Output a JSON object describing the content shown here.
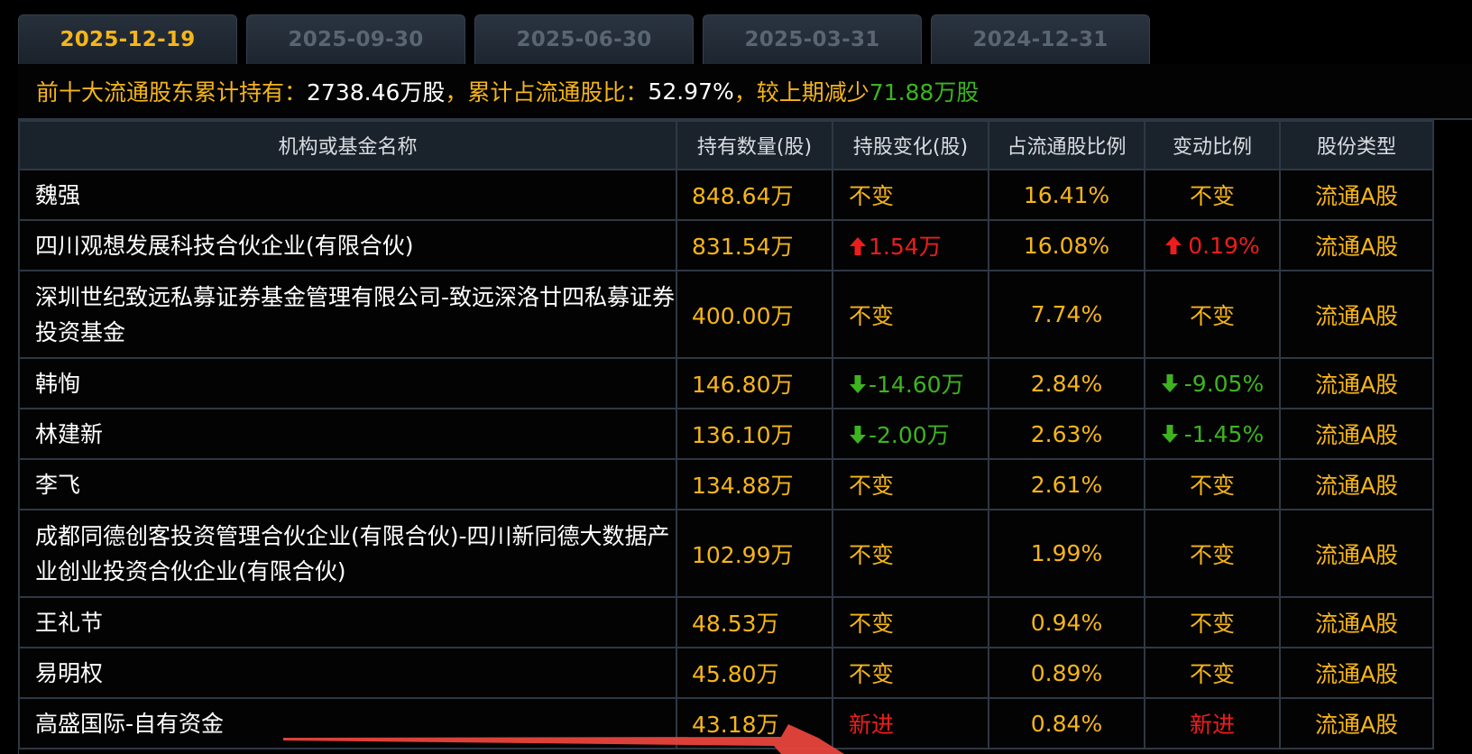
{
  "tabs": [
    {
      "label": "2025-12-19",
      "active": true
    },
    {
      "label": "2025-09-30",
      "active": false
    },
    {
      "label": "2025-06-30",
      "active": false
    },
    {
      "label": "2025-03-31",
      "active": false
    },
    {
      "label": "2024-12-31",
      "active": false
    }
  ],
  "summary": {
    "label1": "前十大流通股东累计持有：",
    "value1": "2738.46万股",
    "label2": "，累计占流通股比：",
    "value2": "52.97%",
    "label3": "，较上期减少",
    "value3": "71.88万股"
  },
  "table": {
    "headers": [
      "机构或基金名称",
      "持有数量(股)",
      "持股变化(股)",
      "占流通股比例",
      "变动比例",
      "股份类型"
    ],
    "rows": [
      {
        "name": "魏强",
        "qty": "848.64万",
        "change": "不变",
        "change_dir": "none",
        "change_color": "yellow",
        "pct": "16.41%",
        "ratio": "不变",
        "ratio_dir": "none",
        "ratio_color": "yellow",
        "type": "流通A股"
      },
      {
        "name": "四川观想发展科技合伙企业(有限合伙)",
        "qty": "831.54万",
        "change": "1.54万",
        "change_dir": "up",
        "change_color": "red",
        "pct": "16.08%",
        "ratio": "0.19%",
        "ratio_dir": "up",
        "ratio_color": "red",
        "type": "流通A股"
      },
      {
        "name": "深圳世纪致远私募证券基金管理有限公司-致远深洛廿四私募证券投资基金",
        "qty": "400.00万",
        "change": "不变",
        "change_dir": "none",
        "change_color": "yellow",
        "pct": "7.74%",
        "ratio": "不变",
        "ratio_dir": "none",
        "ratio_color": "yellow",
        "type": "流通A股",
        "tall": true
      },
      {
        "name": "韩恂",
        "qty": "146.80万",
        "change": "-14.60万",
        "change_dir": "down",
        "change_color": "green",
        "pct": "2.84%",
        "ratio": "-9.05%",
        "ratio_dir": "down",
        "ratio_color": "green",
        "type": "流通A股"
      },
      {
        "name": "林建新",
        "qty": "136.10万",
        "change": "-2.00万",
        "change_dir": "down",
        "change_color": "green",
        "pct": "2.63%",
        "ratio": "-1.45%",
        "ratio_dir": "down",
        "ratio_color": "green",
        "type": "流通A股"
      },
      {
        "name": "李飞",
        "qty": "134.88万",
        "change": "不变",
        "change_dir": "none",
        "change_color": "yellow",
        "pct": "2.61%",
        "ratio": "不变",
        "ratio_dir": "none",
        "ratio_color": "yellow",
        "type": "流通A股"
      },
      {
        "name": "成都同德创客投资管理合伙企业(有限合伙)-四川新同德大数据产业创业投资合伙企业(有限合伙)",
        "qty": "102.99万",
        "change": "不变",
        "change_dir": "none",
        "change_color": "yellow",
        "pct": "1.99%",
        "ratio": "不变",
        "ratio_dir": "none",
        "ratio_color": "yellow",
        "type": "流通A股",
        "tall": true
      },
      {
        "name": "王礼节",
        "qty": "48.53万",
        "change": "不变",
        "change_dir": "none",
        "change_color": "yellow",
        "pct": "0.94%",
        "ratio": "不变",
        "ratio_dir": "none",
        "ratio_color": "yellow",
        "type": "流通A股"
      },
      {
        "name": "易明权",
        "qty": "45.80万",
        "change": "不变",
        "change_dir": "none",
        "change_color": "yellow",
        "pct": "0.89%",
        "ratio": "不变",
        "ratio_dir": "none",
        "ratio_color": "yellow",
        "type": "流通A股"
      },
      {
        "name": "高盛国际-自有资金",
        "qty": "43.18万",
        "change": "新进",
        "change_dir": "none",
        "change_color": "red",
        "pct": "0.84%",
        "ratio": "新进",
        "ratio_dir": "none",
        "ratio_color": "red",
        "type": "流通A股"
      }
    ]
  },
  "colors": {
    "accent_yellow": "#f6b51a",
    "up_red": "#ec1d1d",
    "down_green": "#3db41f",
    "header_bg": "#1a222c",
    "annotation_arrow": "#e8453c"
  },
  "icons": {
    "up": "arrow-up-icon",
    "down": "arrow-down-icon",
    "annotation": "red-annotation-arrow"
  }
}
